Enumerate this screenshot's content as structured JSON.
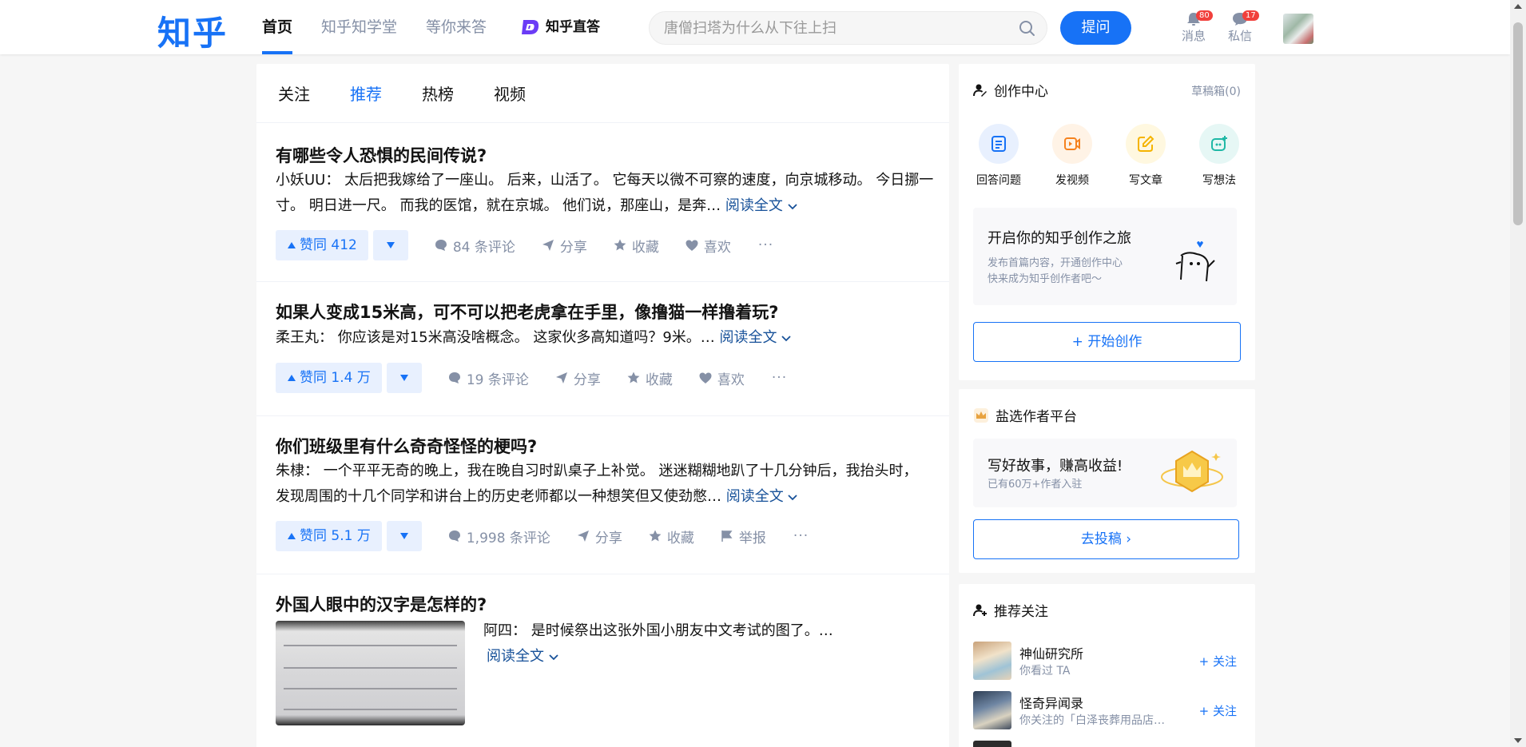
{
  "header": {
    "logo": "知乎",
    "nav": [
      "首页",
      "知乎知学堂",
      "等你来答"
    ],
    "zhida_label": "知乎直答",
    "search_placeholder": "唐僧扫塔为什么从下往上扫",
    "ask_label": "提问",
    "messages_label": "消息",
    "messages_badge": "80",
    "dm_label": "私信",
    "dm_badge": "17"
  },
  "feed": {
    "tabs": [
      "关注",
      "推荐",
      "热榜",
      "视频"
    ],
    "active_tab": "推荐",
    "read_more": "阅读全文",
    "items": [
      {
        "title": "有哪些令人恐惧的民间传说?",
        "excerpt": "小妖UU： 太后把我嫁给了一座山。 后来，山活了。 它每天以微不可察的速度，向京城移动。 今日挪一寸。 明日进一尺。 而我的医馆，就在京城。 他们说，那座山，是奔…",
        "upvote": "赞同 412",
        "comments": "84 条评论",
        "share": "分享",
        "collect": "收藏",
        "like": "喜欢"
      },
      {
        "title": "如果人变成15米高，可不可以把老虎拿在手里，像撸猫一样撸着玩?",
        "excerpt": "柔王丸： 你应该是对15米高没啥概念。 这家伙多高知道吗？9米。…",
        "upvote": "赞同 1.4 万",
        "comments": "19 条评论",
        "share": "分享",
        "collect": "收藏",
        "like": "喜欢"
      },
      {
        "title": "你们班级里有什么奇奇怪怪的梗吗?",
        "excerpt": "朱棣： 一个平平无奇的晚上，我在晚自习时趴桌子上补觉。 迷迷糊糊地趴了十几分钟后，我抬头时，发现周围的十几个同学和讲台上的历史老师都以一种想笑但又使劲憋…",
        "upvote": "赞同 5.1 万",
        "comments": "1,998 条评论",
        "share": "分享",
        "collect": "收藏",
        "report": "举报"
      },
      {
        "title": "外国人眼中的汉字是怎样的?",
        "excerpt": "阿四： 是时候祭出这张外国小朋友中文考试的图了。…"
      }
    ]
  },
  "creator": {
    "title": "创作中心",
    "drafts": "草稿箱(0)",
    "items": [
      "回答问题",
      "发视频",
      "写文章",
      "写想法"
    ],
    "promo_title": "开启你的知乎创作之旅",
    "promo_desc": "发布首篇内容，开通创作中心 快来成为知乎创作者吧～",
    "start_label": "开始创作"
  },
  "salt": {
    "title": "盐选作者平台",
    "promo_title": "写好故事，赚高收益!",
    "promo_desc": "已有60万+作者入驻",
    "submit_label": "去投稿 ›"
  },
  "recommend": {
    "title": "推荐关注",
    "follow_label": "关注",
    "users": [
      {
        "name": "神仙研究所",
        "desc": "你看过 TA"
      },
      {
        "name": "怪奇异闻录",
        "desc": "你关注的「白泽丧葬用品店…"
      }
    ]
  },
  "colors": {
    "brand": "#1772f6",
    "link": "#175199",
    "muted": "#8590a6"
  }
}
